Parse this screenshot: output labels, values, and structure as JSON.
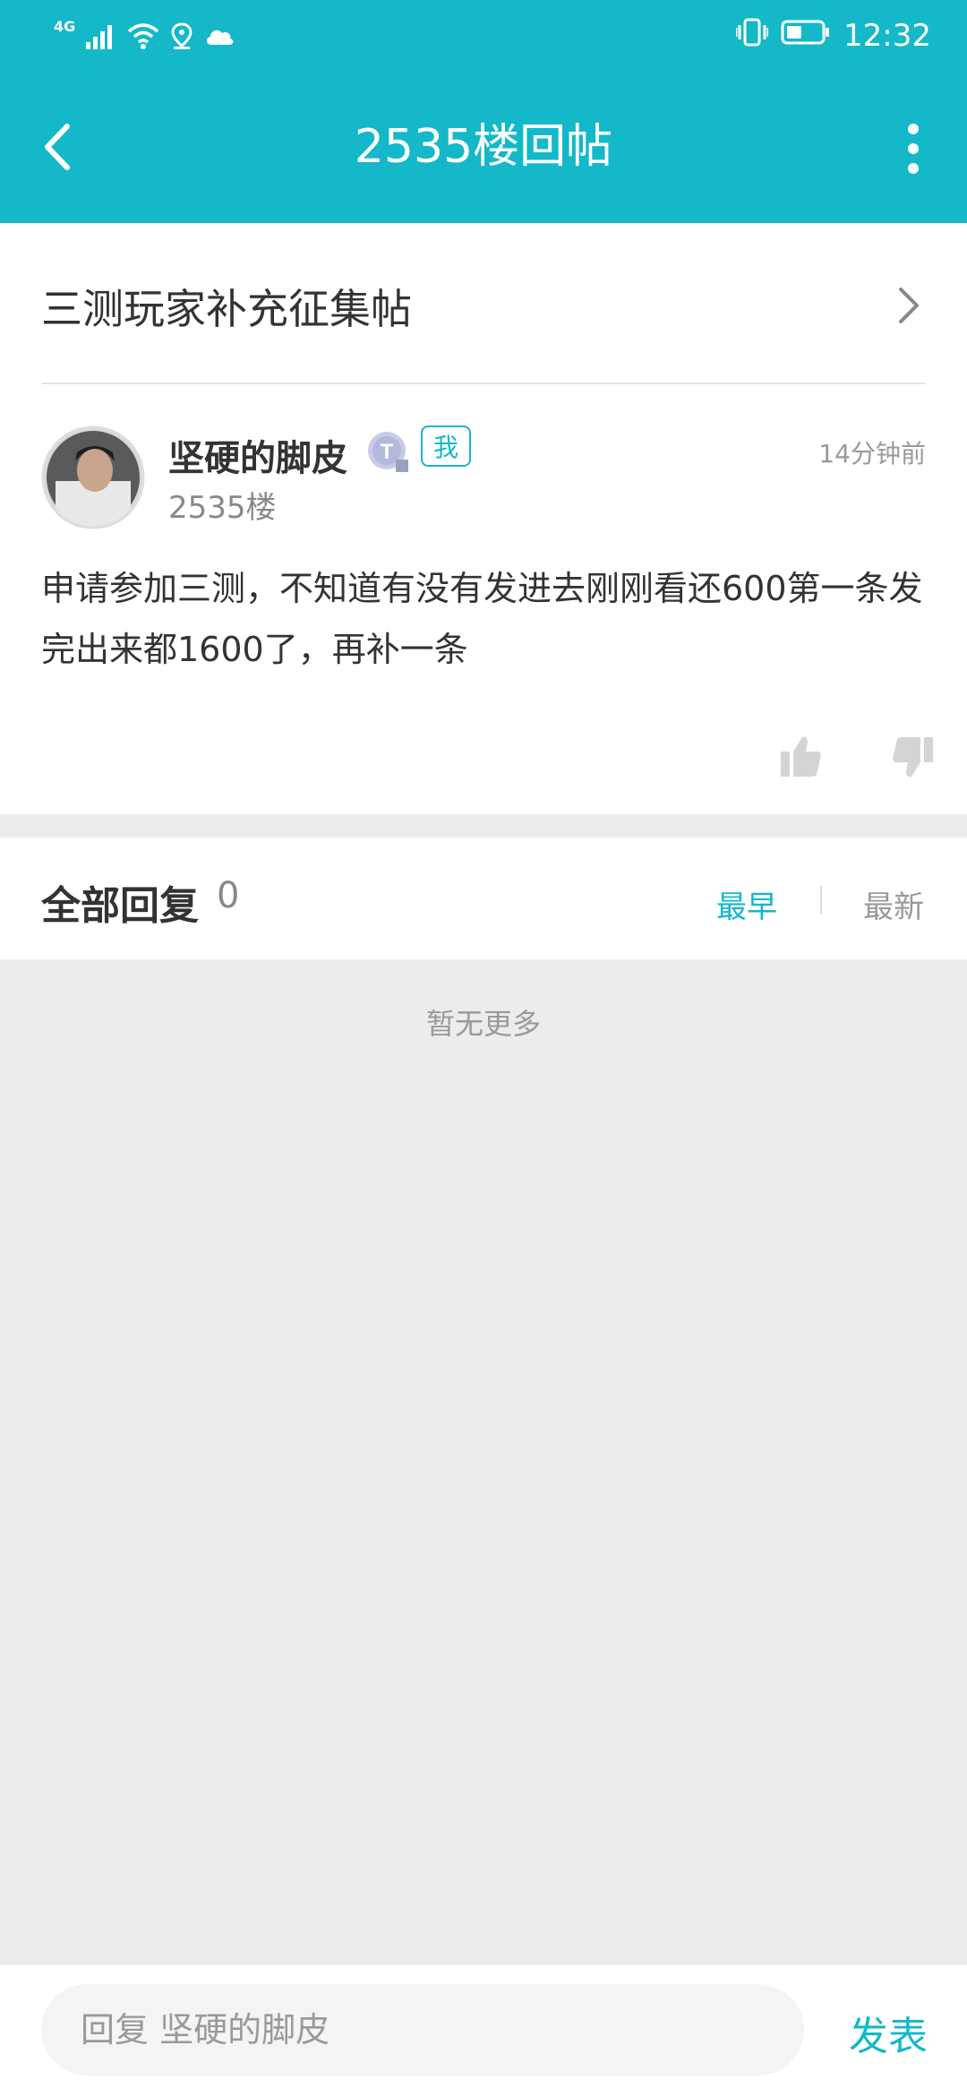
{
  "status_bar": {
    "network": "4G",
    "time": "12:32",
    "icons": [
      "signal-icon",
      "wifi-icon",
      "location-icon",
      "cloud-icon",
      "vibrate-icon",
      "battery-icon"
    ]
  },
  "header": {
    "title": "2535楼回帖",
    "back_icon": "chevron-left-icon",
    "more_icon": "more-vertical-icon"
  },
  "topic": {
    "title": "三测玩家补充征集帖"
  },
  "post": {
    "author": "坚硬的脚皮",
    "level_badge": "T",
    "me_tag": "我",
    "time_ago": "14分钟前",
    "floor": "2535楼",
    "content": "申请参加三测，不知道有没有发进去刚刚看还600第一条发完出来都1600了，再补一条"
  },
  "replies": {
    "title": "全部回复",
    "count": "0",
    "sort_earliest": "最早",
    "sort_newest": "最新",
    "empty_text": "暂无更多"
  },
  "bottom": {
    "reply_placeholder": "回复 坚硬的脚皮",
    "publish_label": "发表"
  },
  "colors": {
    "accent": "#14b8c8",
    "page_bg": "#ececec"
  }
}
